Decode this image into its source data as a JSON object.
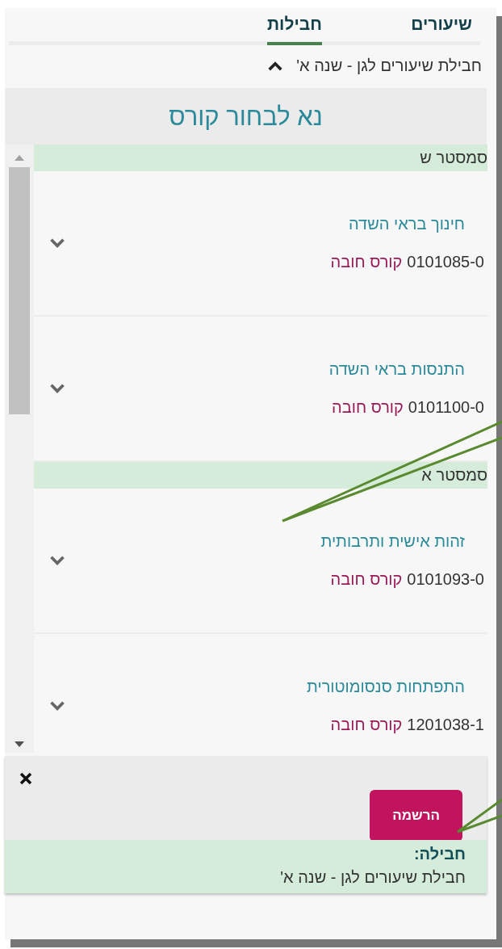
{
  "tabs": [
    {
      "label": "שיעורים",
      "selected": false
    },
    {
      "label": "חבילות",
      "selected": true
    }
  ],
  "package": {
    "title": "חבילת שיעורים לגן - שנה א'",
    "expanded": true
  },
  "heading": "נא לבחור קורס",
  "groups": [
    {
      "title": "סמסטר ש",
      "courses": [
        {
          "name": "חינוך בראי השדה",
          "code": "0101085-0",
          "type": "קורס חובה",
          "expanded": false
        },
        {
          "name": "התנסות בראי השדה",
          "code": "0101100-0",
          "type": "קורס חובה",
          "expanded": false
        }
      ]
    },
    {
      "title": "סמסטר א",
      "courses": [
        {
          "name": "זהות אישית ותרבותית",
          "code": "0101093-0",
          "type": "קורס חובה",
          "expanded": false
        },
        {
          "name": "התפתחות סנסומוטורית",
          "code": "1201038-1",
          "type": "קורס חובה",
          "expanded": false
        }
      ]
    }
  ],
  "panel": {
    "button": "הרשמה",
    "label": "חבילה:",
    "value": "חבילת שיעורים לגן - שנה א'"
  }
}
